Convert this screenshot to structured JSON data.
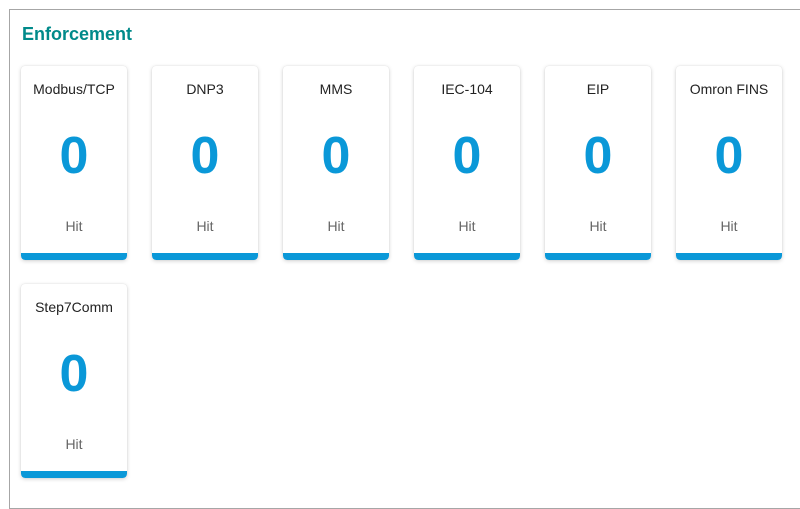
{
  "section": {
    "title": "Enforcement"
  },
  "colors": {
    "title": "#008a8a",
    "accent": "#0a98d8"
  },
  "cards": [
    {
      "label": "Modbus/TCP",
      "value": "0",
      "unit": "Hit"
    },
    {
      "label": "DNP3",
      "value": "0",
      "unit": "Hit"
    },
    {
      "label": "MMS",
      "value": "0",
      "unit": "Hit"
    },
    {
      "label": "IEC-104",
      "value": "0",
      "unit": "Hit"
    },
    {
      "label": "EIP",
      "value": "0",
      "unit": "Hit"
    },
    {
      "label": "Omron FINS",
      "value": "0",
      "unit": "Hit"
    },
    {
      "label": "Step7Comm",
      "value": "0",
      "unit": "Hit"
    }
  ]
}
